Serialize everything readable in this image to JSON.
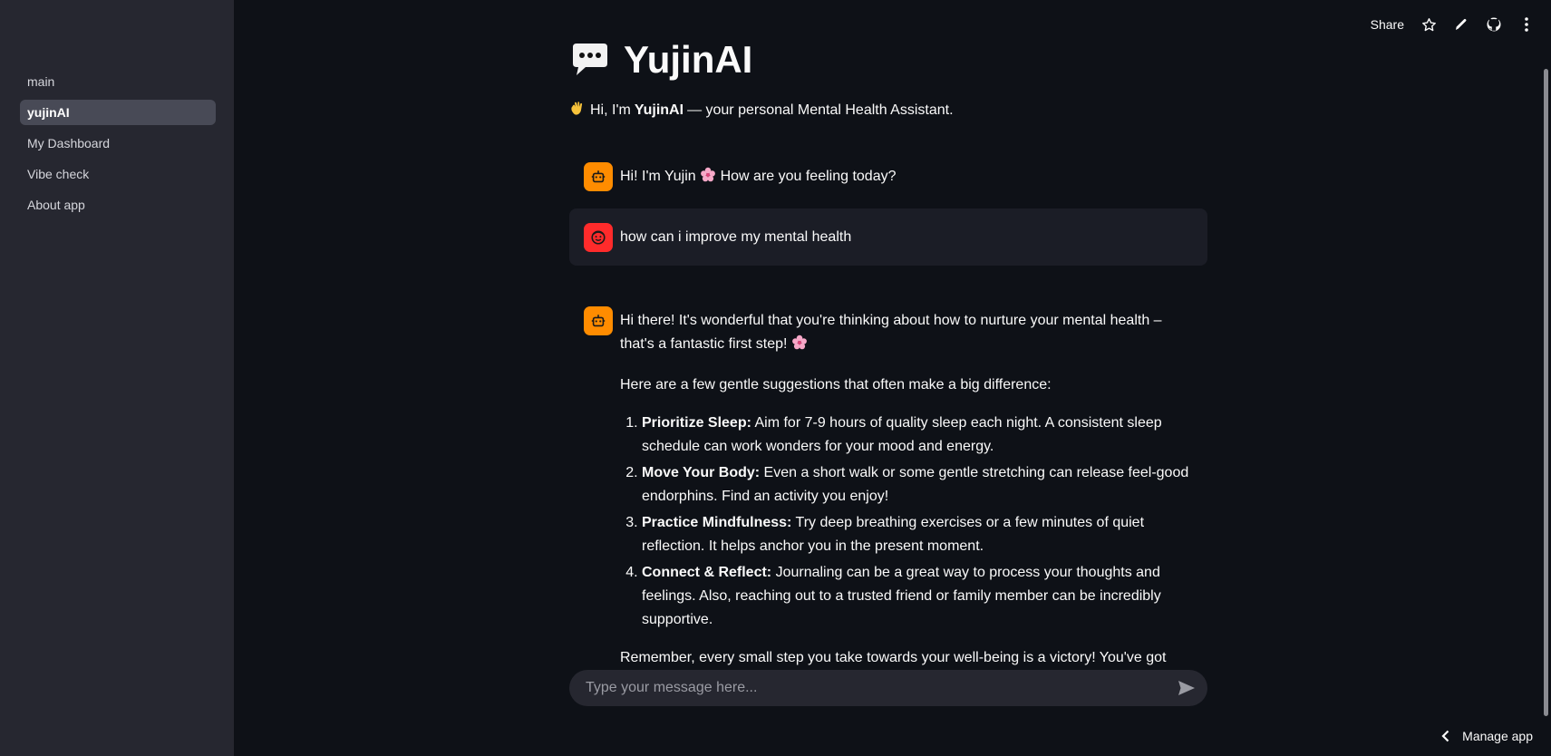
{
  "sidebar": {
    "items": [
      {
        "label": "main",
        "active": false
      },
      {
        "label": "yujinAI",
        "active": true
      },
      {
        "label": "My Dashboard",
        "active": false
      },
      {
        "label": "Vibe check",
        "active": false
      },
      {
        "label": "About app",
        "active": false
      }
    ]
  },
  "toolbar": {
    "share_label": "Share",
    "icons": [
      "star-icon",
      "pencil-icon",
      "github-icon",
      "kebab-menu-icon"
    ]
  },
  "page": {
    "title": "YujinAI",
    "title_icon": "speech-bubble-icon",
    "intro_prefix": "Hi, I'm",
    "intro_name": "YujinAI",
    "intro_suffix": "— your personal Mental Health Assistant.",
    "intro_icon": "waving-hand-icon"
  },
  "messages": {
    "greeting": {
      "role": "assistant",
      "text_before": "Hi! I'm Yujin",
      "text_after": "How are you feeling today?"
    },
    "user_question": {
      "role": "user",
      "text": "how can i improve my mental health"
    },
    "answer": {
      "role": "assistant",
      "intro": "Hi there! It's wonderful that you're thinking about how to nurture your mental health – that's a fantastic first step!",
      "lead": "Here are a few gentle suggestions that often make a big difference:",
      "items": [
        {
          "title": "Prioritize Sleep:",
          "text": "Aim for 7-9 hours of quality sleep each night. A consistent sleep schedule can work wonders for your mood and energy."
        },
        {
          "title": "Move Your Body:",
          "text": "Even a short walk or some gentle stretching can release feel-good endorphins. Find an activity you enjoy!"
        },
        {
          "title": "Practice Mindfulness:",
          "text": "Try deep breathing exercises or a few minutes of quiet reflection. It helps anchor you in the present moment."
        },
        {
          "title": "Connect & Reflect:",
          "text": "Journaling can be a great way to process your thoughts and feelings. Also, reaching out to a trusted friend or family member can be incredibly supportive."
        }
      ],
      "closing": "Remember, every small step you take towards your well-being is a victory! You've got this."
    }
  },
  "chat_input": {
    "placeholder": "Type your message here...",
    "value": ""
  },
  "footer": {
    "manage_label": "Manage app"
  },
  "colors": {
    "background": "#0e1117",
    "sidebar": "#262730",
    "bot_avatar": "#ff8c00",
    "user_avatar": "#ff2b2b",
    "user_message_bg": "#1b1d26"
  }
}
